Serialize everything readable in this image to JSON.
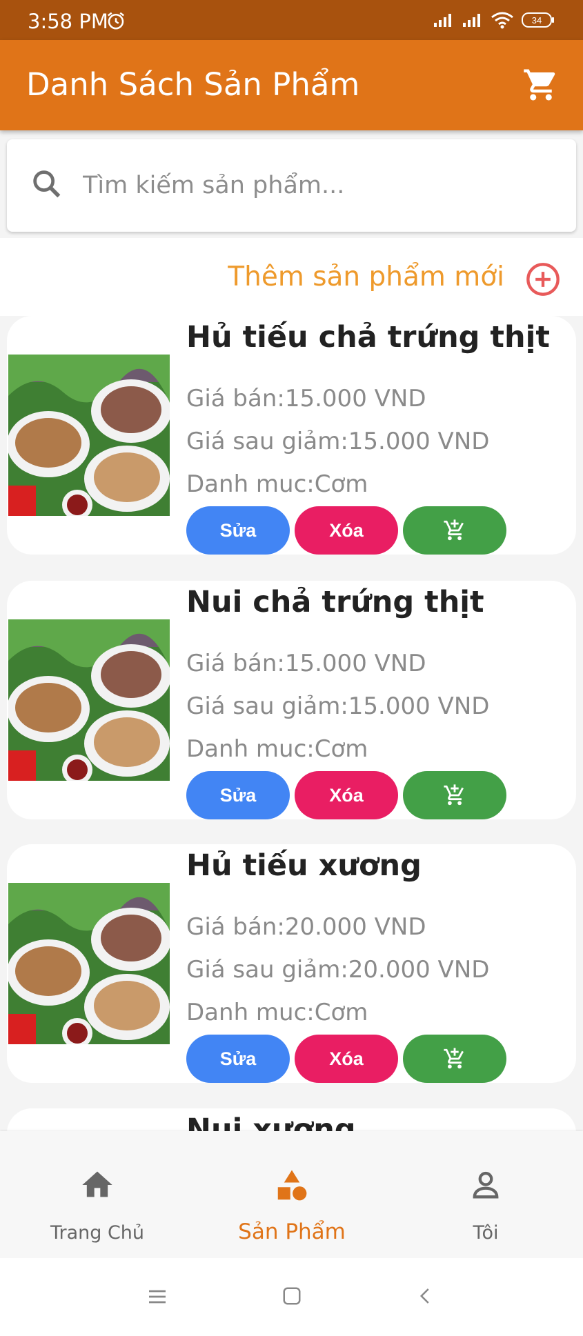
{
  "status_bar": {
    "time": "3:58 PM",
    "battery": "34"
  },
  "app_bar": {
    "title": "Danh Sách Sản Phẩm"
  },
  "search": {
    "placeholder": "Tìm kiếm sản phẩm..."
  },
  "add_product": {
    "label": "Thêm sản phẩm mới"
  },
  "products": [
    {
      "name": "Hủ tiếu chả trứng thịt",
      "price": "Giá bán:15.000 VND",
      "sale_price": "Giá sau giảm:15.000 VND",
      "category": "Danh muc:Cơm",
      "edit": "Sửa",
      "delete": "Xóa"
    },
    {
      "name": "Nui chả trứng thịt",
      "price": "Giá bán:15.000 VND",
      "sale_price": "Giá sau giảm:15.000 VND",
      "category": "Danh muc:Cơm",
      "edit": "Sửa",
      "delete": "Xóa"
    },
    {
      "name": "Hủ tiếu xương",
      "price": "Giá bán:20.000 VND",
      "sale_price": "Giá sau giảm:20.000 VND",
      "category": "Danh muc:Cơm",
      "edit": "Sửa",
      "delete": "Xóa"
    },
    {
      "name": "Nui xương"
    }
  ],
  "bottom_nav": [
    {
      "label": "Trang Chủ",
      "icon": "home-icon"
    },
    {
      "label": "Sản Phẩm",
      "icon": "shapes-icon",
      "active": true
    },
    {
      "label": "Tôi",
      "icon": "person-icon"
    }
  ],
  "colors": {
    "primary": "#e07418",
    "status_bar": "#a8520e",
    "edit": "#4285f4",
    "delete": "#e91e63",
    "cart": "#43a047",
    "accent_text": "#ee9a2c"
  }
}
